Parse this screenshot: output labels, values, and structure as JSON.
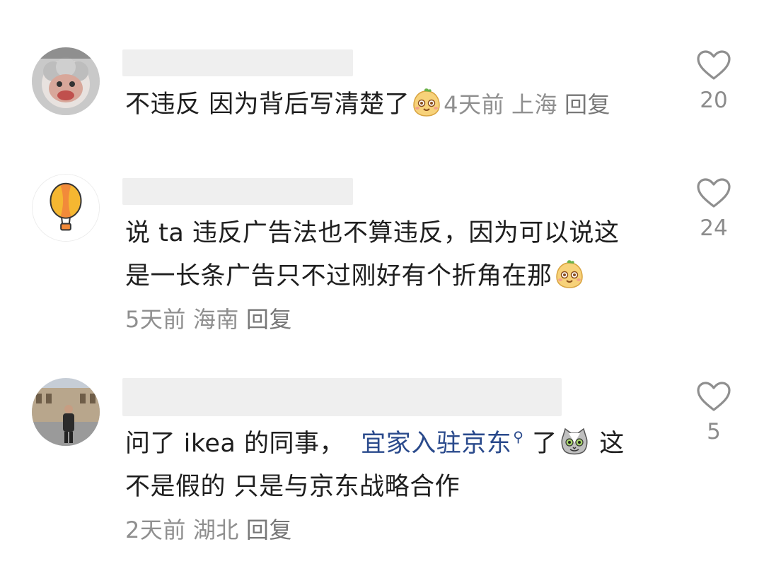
{
  "comments": [
    {
      "text_before": "不违反 因为背后写清楚了",
      "emoji": "smug-face-emoji",
      "time": "4天前",
      "location": "上海",
      "reply": "回复",
      "likes": "20"
    },
    {
      "text_line1": "说 ta 违反广告法也不算违反，因为可以说这",
      "text_line2": "是一长条广告只不过刚好有个折角在那",
      "emoji": "smug-face-emoji",
      "time": "5天前",
      "location": "海南",
      "reply": "回复",
      "likes": "24"
    },
    {
      "text_before": "问了 ikea 的同事，",
      "link_text": "宜家入驻京东",
      "text_after": "了",
      "emoji": "cat-face-emoji",
      "text_tail": "这",
      "text_line2": "不是假的 只是与京东战略合作",
      "time": "2天前",
      "location": "湖北",
      "reply": "回复",
      "likes": "5"
    }
  ],
  "colors": {
    "text": "#1e1e1e",
    "meta": "#8f8f8f",
    "link": "#2a4a8c",
    "name_placeholder": "#efefef"
  },
  "icons": {
    "like": "heart-outline-icon",
    "link": "search-link-icon"
  }
}
